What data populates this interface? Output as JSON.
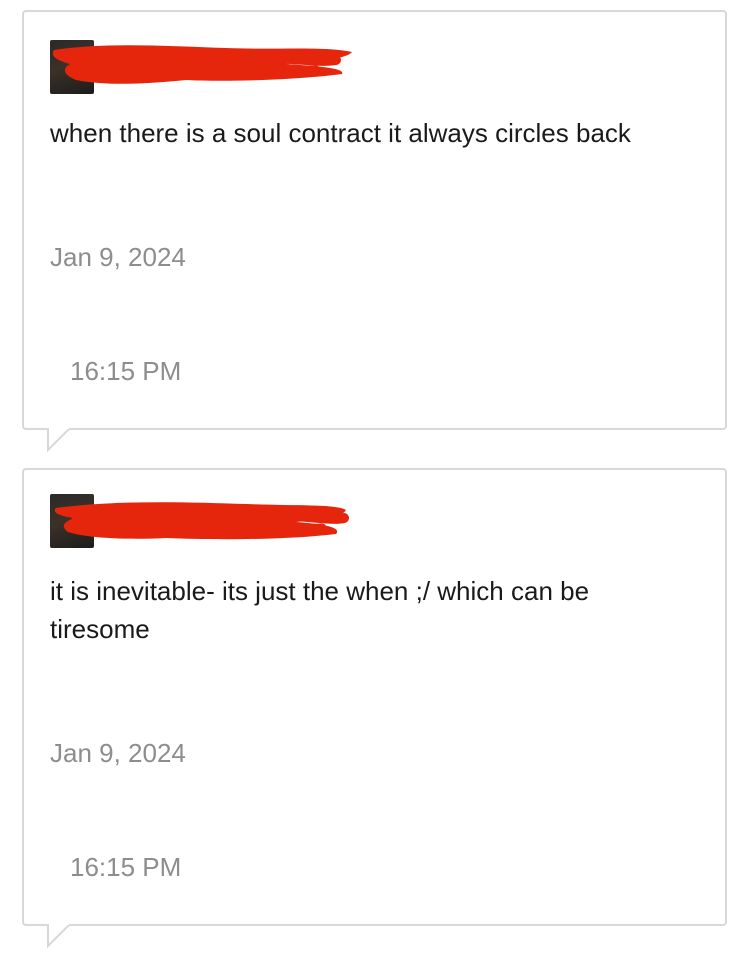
{
  "messages": [
    {
      "text": "when there is a soul contract it always circles back",
      "date": "Jan 9, 2024",
      "time": "16:15 PM"
    },
    {
      "text": "it is inevitable- its just the when ;/ which can be tiresome",
      "date": "Jan 9, 2024",
      "time": "16:15 PM"
    }
  ],
  "colors": {
    "redaction": "#e5260c",
    "bubble_border": "#d8d8d8",
    "meta_text": "#8d8d8d"
  }
}
